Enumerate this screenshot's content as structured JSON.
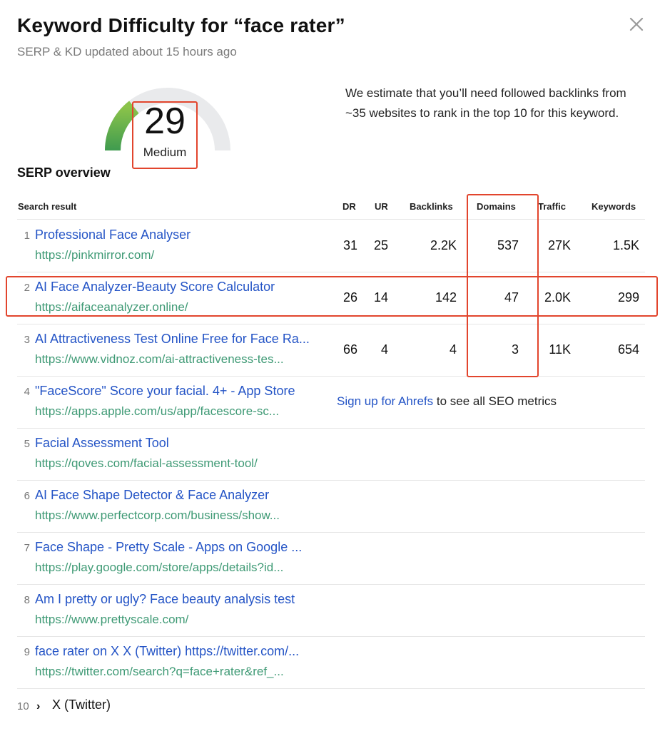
{
  "header": {
    "title": "Keyword Difficulty for “face rater”",
    "subtitle": "SERP & KD updated about 15 hours ago"
  },
  "kd": {
    "score": "29",
    "level": "Medium",
    "fraction": 0.29,
    "colors": {
      "fill": "#4caf50",
      "track": "#e9eaec"
    }
  },
  "estimate": "We estimate that you’ll need followed backlinks from ~35 websites to rank in the top 10 for this keyword.",
  "serp": {
    "title": "SERP overview",
    "columns": {
      "result": "Search result",
      "dr": "DR",
      "ur": "UR",
      "backlinks": "Backlinks",
      "domains": "Domains",
      "traffic": "Traffic",
      "keywords": "Keywords"
    },
    "rows": [
      {
        "rank": "1",
        "title": "Professional Face Analyser",
        "url": "https://pinkmirror.com/",
        "dr": "31",
        "ur": "25",
        "backlinks": "2.2K",
        "domains": "537",
        "traffic": "27K",
        "keywords": "1.5K"
      },
      {
        "rank": "2",
        "title": "AI Face Analyzer-Beauty Score Calculator",
        "url": "https://aifaceanalyzer.online/",
        "dr": "26",
        "ur": "14",
        "backlinks": "142",
        "domains": "47",
        "traffic": "2.0K",
        "keywords": "299"
      },
      {
        "rank": "3",
        "title": "AI Attractiveness Test Online Free for Face Ra...",
        "url": "https://www.vidnoz.com/ai-attractiveness-tes...",
        "dr": "66",
        "ur": "4",
        "backlinks": "4",
        "domains": "3",
        "traffic": "11K",
        "keywords": "654"
      },
      {
        "rank": "4",
        "title": "\"FaceScore\" Score your facial. 4+ - App Store",
        "url": "https://apps.apple.com/us/app/facescore-sc..."
      },
      {
        "rank": "5",
        "title": "Facial Assessment Tool",
        "url": "https://qoves.com/facial-assessment-tool/"
      },
      {
        "rank": "6",
        "title": "AI Face Shape Detector & Face Analyzer",
        "url": "https://www.perfectcorp.com/business/show..."
      },
      {
        "rank": "7",
        "title": "Face Shape - Pretty Scale - Apps on Google ...",
        "url": "https://play.google.com/store/apps/details?id..."
      },
      {
        "rank": "8",
        "title": "Am I pretty or ugly? Face beauty analysis test",
        "url": "https://www.prettyscale.com/"
      },
      {
        "rank": "9",
        "title": "face rater on X X (Twitter) https://twitter.com/...",
        "url": "https://twitter.com/search?q=face+rater&ref_..."
      }
    ],
    "signup": {
      "link": "Sign up for Ahrefs",
      "rest": " to see all SEO metrics"
    },
    "last": {
      "rank": "10",
      "chevron": "›",
      "title": "X (Twitter)"
    }
  }
}
